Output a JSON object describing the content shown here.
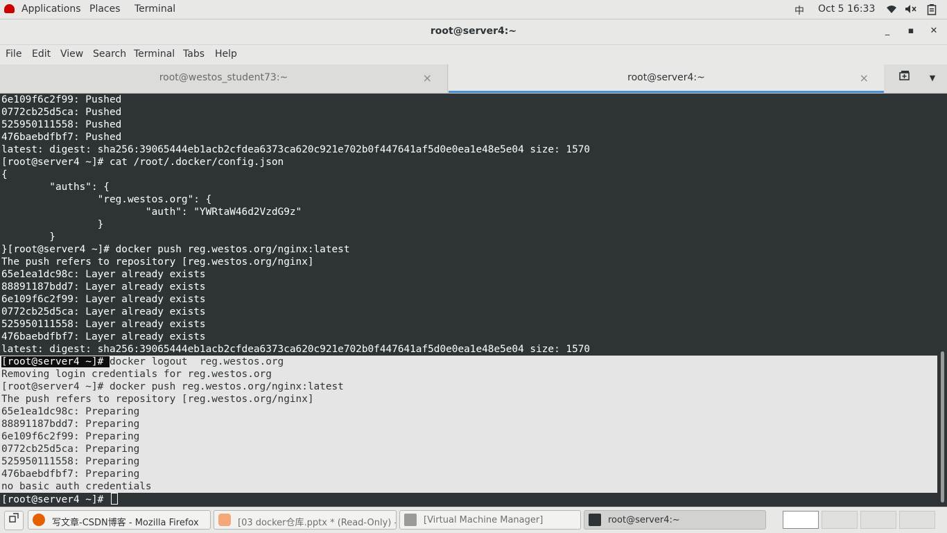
{
  "topbar": {
    "applications": "Applications",
    "places": "Places",
    "terminal": "Terminal",
    "input_method": "中",
    "date": "Oct 5",
    "time": "16:33",
    "icons": [
      "redhat-icon",
      "wifi-icon",
      "volume-muted-icon",
      "battery-icon"
    ]
  },
  "window": {
    "title": "root@server4:~",
    "minimize": "_",
    "maximize": "▪",
    "close": "✕"
  },
  "menubar": [
    "File",
    "Edit",
    "View",
    "Search",
    "Terminal",
    "Tabs",
    "Help"
  ],
  "tabs": [
    {
      "label": "root@westos_student73:~",
      "close": "×",
      "active": false
    },
    {
      "label": "root@server4:~",
      "close": "×",
      "active": true
    }
  ],
  "tab_actions": {
    "new_tab": "⎘",
    "menu": "▼"
  },
  "terminal": {
    "lines": [
      "6e109f6c2f99: Pushed",
      "0772cb25d5ca: Pushed",
      "525950111558: Pushed",
      "476baebdfbf7: Pushed",
      "latest: digest: sha256:39065444eb1acb2cfdea6373ca620c921e702b0f447641af5d0e0ea1e48e5e04 size: 1570",
      "[root@server4 ~]# cat /root/.docker/config.json",
      "{",
      "        \"auths\": {",
      "                \"reg.westos.org\": {",
      "                        \"auth\": \"YWRtaW46d2VzdG9z\"",
      "                }",
      "        }",
      "}[root@server4 ~]# docker push reg.westos.org/nginx:latest",
      "The push refers to repository [reg.westos.org/nginx]",
      "65e1ea1dc98c: Layer already exists",
      "88891187bdd7: Layer already exists",
      "6e109f6c2f99: Layer already exists",
      "0772cb25d5ca: Layer already exists",
      "525950111558: Layer already exists",
      "476baebdfbf7: Layer already exists",
      "latest: digest: sha256:39065444eb1acb2cfdea6373ca620c921e702b0f447641af5d0e0ea1e48e5e04 size: 1570"
    ],
    "selected_prompt": "[root@server4 ~]# ",
    "selected_command": "docker logout  reg.westos.org",
    "selected_lines": [
      "Removing login credentials for reg.westos.org",
      "[root@server4 ~]# docker push reg.westos.org/nginx:latest",
      "The push refers to repository [reg.westos.org/nginx]",
      "65e1ea1dc98c: Preparing",
      "88891187bdd7: Preparing",
      "6e109f6c2f99: Preparing",
      "0772cb25d5ca: Preparing",
      "525950111558: Preparing",
      "476baebdfbf7: Preparing",
      "no basic auth credentials"
    ],
    "prompt": "[root@server4 ~]# "
  },
  "taskbar": {
    "show_desktop_icon": "show-desktop-icon",
    "tasks": [
      {
        "label": "写文章-CSDN博客 - Mozilla Firefox",
        "icon": "firefox-icon",
        "color": "#e66000",
        "active": false,
        "dim": false
      },
      {
        "label": "[03 docker仓库.pptx * (Read-Only) -...",
        "icon": "impress-icon",
        "color": "#f4a87a",
        "active": false,
        "dim": true
      },
      {
        "label": "[Virtual Machine Manager]",
        "icon": "virt-manager-icon",
        "color": "#9a9a98",
        "active": false,
        "dim": true
      },
      {
        "label": "root@server4:~",
        "icon": "terminal-icon",
        "color": "#2e3436",
        "active": true,
        "dim": false
      }
    ],
    "workspaces": 4,
    "current_workspace": 1
  }
}
